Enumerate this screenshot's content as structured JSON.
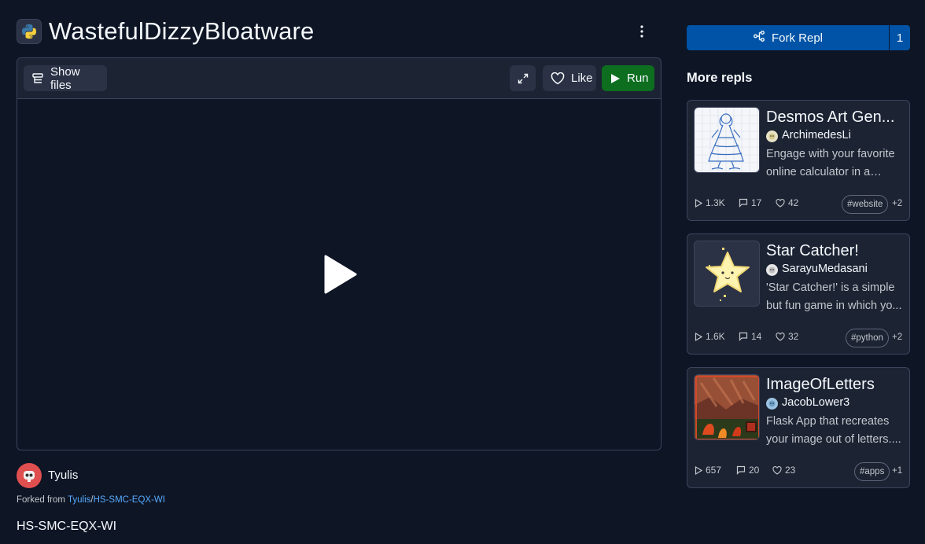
{
  "repl": {
    "title": "WastefulDizzyBloatware",
    "language_icon": "python-icon",
    "description": "HS-SMC-EQX-WI"
  },
  "toolbar": {
    "show_files_label": "Show files",
    "like_label": "Like",
    "run_label": "Run"
  },
  "author": {
    "name": "Tyulis",
    "forked_prefix": "Forked from ",
    "forked_user": "Tyulis",
    "forked_sep": "/",
    "forked_repl": "HS-SMC-EQX-WI"
  },
  "sidebar": {
    "fork_label": "Fork Repl",
    "fork_count": "1",
    "more_title": "More repls",
    "cards": [
      {
        "title": "Desmos Art Gen...",
        "author": "ArchimedesLi",
        "description": "Engage with your favorite online calculator in a new...",
        "runs": "1.3K",
        "comments": "17",
        "likes": "42",
        "tag": "#website",
        "more_tags": "+2"
      },
      {
        "title": "Star Catcher!",
        "author": "SarayuMedasani",
        "description": "'Star Catcher!' is a simple but fun game in which yo...",
        "runs": "1.6K",
        "comments": "14",
        "likes": "32",
        "tag": "#python",
        "more_tags": "+2"
      },
      {
        "title": "ImageOfLetters",
        "author": "JacobLower3",
        "description": "Flask App that recreates your image out of letters....",
        "runs": "657",
        "comments": "20",
        "likes": "23",
        "tag": "#apps",
        "more_tags": "+1"
      }
    ]
  },
  "colors": {
    "background": "#0e1525",
    "surface": "#1c2333",
    "border": "#3c445c",
    "fork_blue": "#0053a6",
    "run_green": "#0d6e1f",
    "link": "#57abff"
  }
}
